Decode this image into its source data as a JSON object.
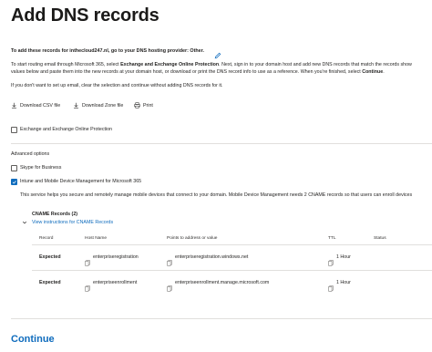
{
  "page": {
    "title": "Add DNS records",
    "intro_heading": "To add these records for inthecloud247.nl, go to your DNS hosting provider: Other.",
    "paragraph_lines": [
      [
        "To start routing email through Microsoft 365, select ",
        "Exchange and Exchange Online Protection",
        ". Next, sign in to your domain host and add new DNS records that match the records show"
      ],
      [
        "values below and paste them into the new records at your domain host, or download or print the DNS record info to use as a reference. When you're finished, select ",
        "Continue",
        "."
      ]
    ],
    "note": "If you don't want to set up email, clear the selection and continue without adding DNS records for it."
  },
  "toolbar": {
    "download_csv": "Download CSV file",
    "download_zone": "Download Zone file",
    "print": "Print"
  },
  "options": {
    "exchange": {
      "label": "Exchange and Exchange Online Protection",
      "checked": false
    },
    "advanced_title": "Advanced options",
    "skype": {
      "label": "Skype for Business",
      "checked": false
    },
    "intune": {
      "label": "Intune and Mobile Device Management for Microsoft 365",
      "checked": true
    },
    "intune_description": "This service helps you secure and remotely manage mobile devices that connect to your domain. Mobile Device Management needs 2 CNAME records so that users can enroll devices"
  },
  "cname": {
    "title": "CNAME Records (2)",
    "instructions_link": "View instructions for CNAME Records",
    "headers": [
      "Record",
      "Host Name",
      "Points to address or value",
      "TTL",
      "Status"
    ],
    "rows": [
      {
        "record": "Expected",
        "host": "enterpriseregistration",
        "points_to": "enterpriseregistration.windows.net",
        "ttl": "1 Hour",
        "status": ""
      },
      {
        "record": "Expected",
        "host": "enterpriseenrollment",
        "points_to": "enterpriseenrollment.manage.microsoft.com",
        "ttl": "1 Hour",
        "status": ""
      }
    ]
  },
  "footer": {
    "continue_label": "Continue"
  },
  "colors": {
    "accent": "#0f6cbd",
    "text": "#201f1e",
    "divider": "#e1dfdd"
  }
}
